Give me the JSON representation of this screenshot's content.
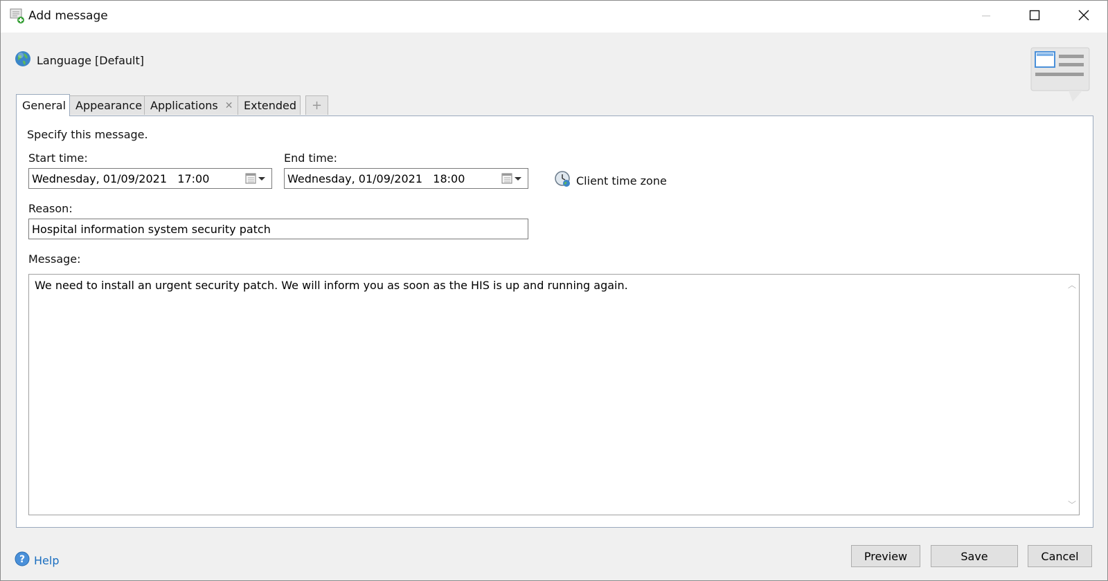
{
  "window": {
    "title": "Add message",
    "icons": {
      "app": "add-message-icon",
      "minimize": "minimize-icon",
      "maximize": "maximize-icon",
      "close": "close-icon"
    }
  },
  "language": {
    "label": "Language [Default]",
    "icon": "globe-icon"
  },
  "tabs": [
    {
      "label": "General",
      "active": true
    },
    {
      "label": "Appearance"
    },
    {
      "label": "Applications",
      "closable": true
    },
    {
      "label": "Extended"
    }
  ],
  "general": {
    "instruction": "Specify this message.",
    "start_time": {
      "label": "Start time:",
      "value": "Wednesday, 01/09/2021   17:00"
    },
    "end_time": {
      "label": "End time:",
      "value": "Wednesday, 01/09/2021   18:00"
    },
    "client_time_zone": "Client time zone",
    "reason": {
      "label": "Reason:",
      "value": "Hospital information system security patch"
    },
    "message": {
      "label": "Message:",
      "value": "We need to install an urgent security patch. We will inform you as soon as the HIS is up and running again."
    }
  },
  "footer": {
    "help": "Help",
    "preview": "Preview",
    "save": "Save",
    "cancel": "Cancel"
  },
  "colors": {
    "accent": "#1a6ec0",
    "panel_border": "#9aa9bd"
  }
}
